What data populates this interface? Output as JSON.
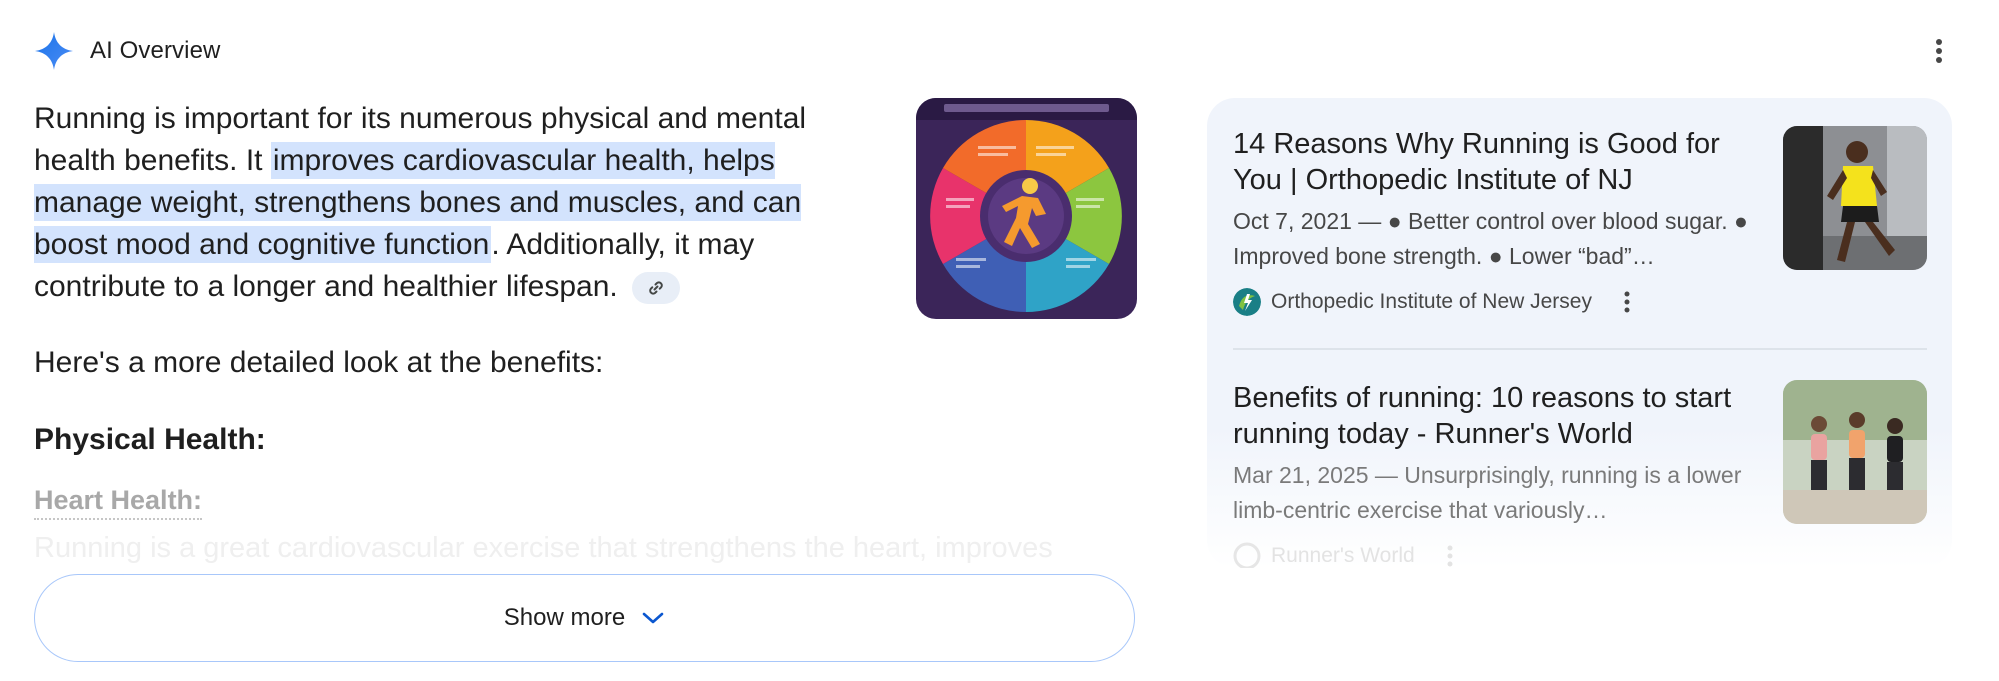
{
  "header": {
    "title": "AI Overview",
    "icon": "sparkle-icon",
    "menu_icon": "more-vert-icon"
  },
  "answer": {
    "part1": "Running is important for its numerous physical and mental health benefits. It ",
    "highlight": "improves cardiovascular health, helps manage weight, strengthens bones and muscles, and can boost mood and cognitive function",
    "part2": ". Additionally, it may contribute to a longer and healthier lifespan.",
    "link_icon": "link-icon"
  },
  "hero_image": {
    "icon": "running-benefits-infographic"
  },
  "subhead": "Here's a more detailed look at the benefits:",
  "section_title": "Physical Health:",
  "heart_heading": "Heart Health:",
  "faded_text": "Running is a great cardiovascular exercise that strengthens the heart, improves",
  "show_more": {
    "label": "Show more",
    "icon": "chevron-down-icon"
  },
  "sources": [
    {
      "title": "14 Reasons Why Running is Good for You | Orthopedic Institute of NJ",
      "snippet": "Oct 7, 2021 — ● Better control over blood sugar. ● Improved bone strength. ● Lower “bad”…",
      "source_name": "Orthopedic Institute of New Jersey",
      "favicon": "oinj-favicon",
      "thumb": "runner-yellow-shirt-photo"
    },
    {
      "title": "Benefits of running: 10 reasons to start running today - Runner's World",
      "snippet": "Mar 21, 2025 — Unsurprisingly, running is a lower limb-centric exercise that variously…",
      "source_name": "Runner's World",
      "favicon": "runners-world-favicon",
      "thumb": "three-women-running-photo"
    }
  ],
  "colors": {
    "highlight": "#d3e3fd",
    "accent": "#0b57d0",
    "panel": "#f0f4fb"
  }
}
